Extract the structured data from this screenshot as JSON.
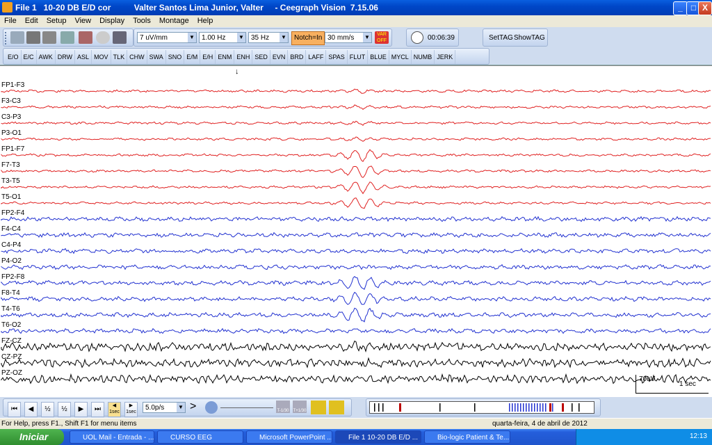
{
  "window": {
    "title": "File 1   10-20 DB E/D cor          Valter Santos Lima Junior, Valter     - Ceegraph Vision  7.15.06",
    "controls": [
      "_",
      "□",
      "X"
    ]
  },
  "menu": [
    "File",
    "Edit",
    "Setup",
    "View",
    "Display",
    "Tools",
    "Montage",
    "Help"
  ],
  "toolbar": {
    "sensitivity": "7 uV/mm",
    "low_filter": "1.00 Hz",
    "high_filter": "35 Hz",
    "notch": "Notch=In",
    "speed": "30 mm/s",
    "var_off": "VAR OFF",
    "timer": "00:06:39",
    "settag": "SetTAG",
    "showtag": "ShowTAG"
  },
  "event_buttons": [
    "E/O",
    "E/C",
    "AWK",
    "DRW",
    "ASL",
    "MOV",
    "TLK",
    "CHW",
    "SWA",
    "SNO",
    "E/M",
    "E/H",
    "ENM",
    "ENH",
    "SED",
    "EVN",
    "BRD",
    "LAFF",
    "SPAS",
    "FLUT",
    "BLUE",
    "MYCL",
    "NUMB",
    "JERK"
  ],
  "channels": [
    {
      "label": "FP1-F3",
      "color": "#e02020"
    },
    {
      "label": "F3-C3",
      "color": "#e02020"
    },
    {
      "label": "C3-P3",
      "color": "#e02020"
    },
    {
      "label": "P3-O1",
      "color": "#e02020"
    },
    {
      "label": "FP1-F7",
      "color": "#e02020"
    },
    {
      "label": "F7-T3",
      "color": "#e02020"
    },
    {
      "label": "T3-T5",
      "color": "#e02020"
    },
    {
      "label": "T5-O1",
      "color": "#e02020"
    },
    {
      "label": "FP2-F4",
      "color": "#2030d0"
    },
    {
      "label": "F4-C4",
      "color": "#2030d0"
    },
    {
      "label": "C4-P4",
      "color": "#2030d0"
    },
    {
      "label": "P4-O2",
      "color": "#2030d0"
    },
    {
      "label": "FP2-F8",
      "color": "#2030d0"
    },
    {
      "label": "F8-T4",
      "color": "#2030d0"
    },
    {
      "label": "T4-T6",
      "color": "#2030d0"
    },
    {
      "label": "T6-O2",
      "color": "#2030d0"
    },
    {
      "label": "FZ-CZ",
      "color": "#000000"
    },
    {
      "label": "CZ-PZ",
      "color": "#000000"
    },
    {
      "label": "PZ-OZ",
      "color": "#000000"
    }
  ],
  "scale": {
    "amplitude": "70uV",
    "time": "1 sec"
  },
  "playback": {
    "step_back_label": "1sec",
    "step_fwd_label": "1sec",
    "rate": "5.0p/s",
    "prev_label": "T-1/30",
    "next_label": "T+1/30"
  },
  "status": {
    "help": "For Help, press F1., Shift F1 for menu items",
    "date": "quarta-feira, 4 de abril de 2012"
  },
  "taskbar": {
    "start": "Iniciar",
    "tasks": [
      "UOL Mail - Entrada - ...",
      "CURSO EEG",
      "Microsoft PowerPoint ...",
      "File 1   10-20 DB E/D ...",
      "Bio-logic Patient & Te..."
    ],
    "clock": "12:13"
  }
}
